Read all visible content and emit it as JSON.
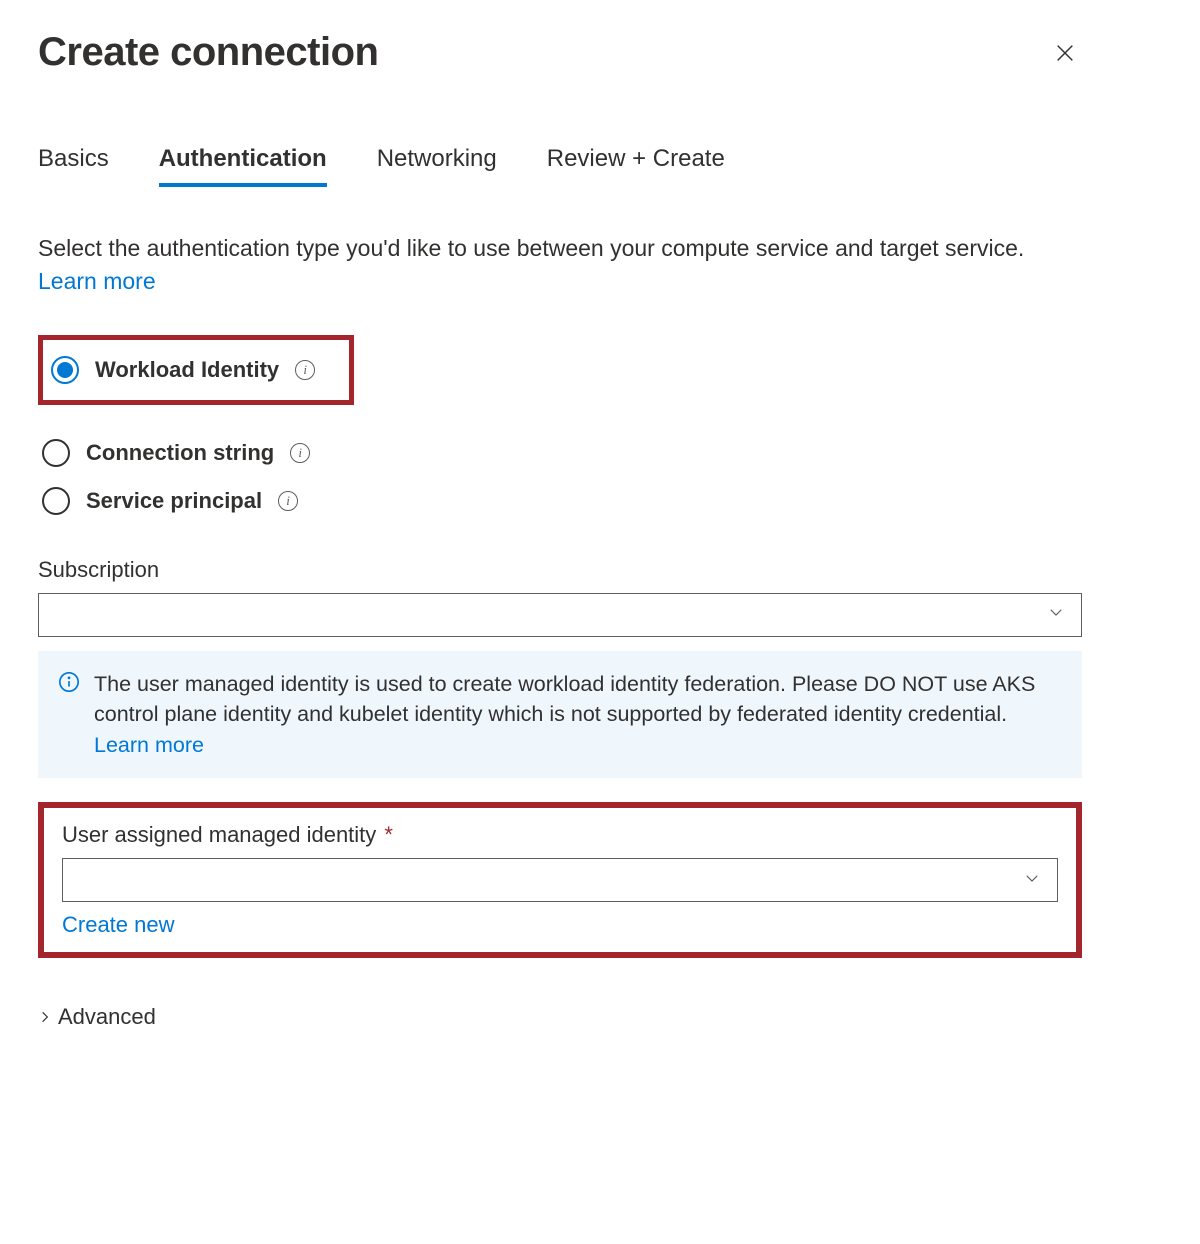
{
  "header": {
    "title": "Create connection"
  },
  "tabs": [
    {
      "label": "Basics",
      "active": false
    },
    {
      "label": "Authentication",
      "active": true
    },
    {
      "label": "Networking",
      "active": false
    },
    {
      "label": "Review + Create",
      "active": false
    }
  ],
  "intro": {
    "text": "Select the authentication type you'd like to use between your compute service and target service. ",
    "link": "Learn more"
  },
  "auth_options": [
    {
      "label": "Workload Identity",
      "selected": true
    },
    {
      "label": "Connection string",
      "selected": false
    },
    {
      "label": "Service principal",
      "selected": false
    }
  ],
  "subscription": {
    "label": "Subscription",
    "value": ""
  },
  "info_banner": {
    "text": "The user managed identity is used to create workload identity federation. Please DO NOT use AKS control plane identity and kubelet identity which is not supported by federated identity credential. ",
    "link": "Learn more"
  },
  "uami": {
    "label": "User assigned managed identity",
    "required_marker": "*",
    "value": "",
    "create_new": "Create new"
  },
  "advanced": {
    "label": "Advanced"
  }
}
